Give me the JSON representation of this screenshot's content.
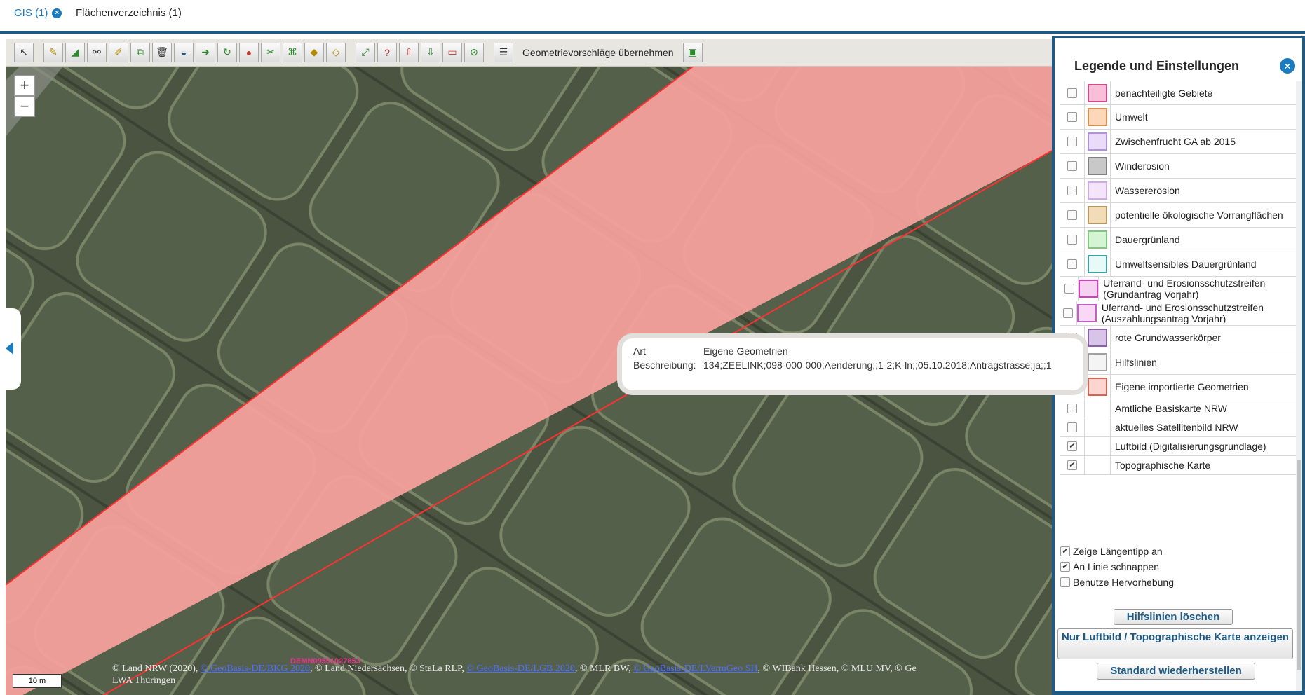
{
  "tabs": [
    {
      "label": "GIS (1)",
      "active": true
    },
    {
      "label": "Flächenverzeichnis (1)",
      "active": false
    }
  ],
  "toolbar": {
    "icons": [
      "pointer-icon",
      "pencil-icon",
      "polygon-icon",
      "split-icon",
      "edit-icon",
      "merge-icon",
      "trash-icon",
      "layer-icon",
      "move-icon",
      "rotate-icon",
      "marker-icon",
      "cut-icon",
      "join-icon",
      "paint-icon",
      "paint-edit-icon",
      "expand-icon",
      "help-icon",
      "upload-icon",
      "download-icon",
      "shape-icon",
      "lock-icon",
      "list-icon"
    ],
    "geometry_label": "Geometrievorschläge übernehmen"
  },
  "map": {
    "zoom_in": "+",
    "zoom_out": "−",
    "scale": "10 m",
    "stamp": "DEMN09551027853",
    "copyright_parts": [
      {
        "t": "© Land NRW (2020), ",
        "link": false
      },
      {
        "t": "© GeoBasis-DE/BKG 2020",
        "link": true
      },
      {
        "t": ", © Land Niedersachsen, © StaLa RLP, ",
        "link": false
      },
      {
        "t": "© GeoBasis-DE/LGB 2020",
        "link": true
      },
      {
        "t": ", © MLR BW, ",
        "link": false
      },
      {
        "t": "© GeoBasis-DE/LVermGeo SH",
        "link": true
      },
      {
        "t": ", © WIBank Hessen, © MLU MV, © Ge",
        "link": false
      }
    ],
    "copyright_line2": "LWA Thüringen"
  },
  "tooltip": {
    "rows": [
      {
        "key": "Art",
        "value": "Eigene Geometrien"
      },
      {
        "key": "Beschreibung:",
        "value": "134;ZEELINK;098-000-000;Aenderung;;1-2;K-ln;;05.10.2018;Antragstrasse;ja;;1"
      }
    ]
  },
  "panel": {
    "title": "Legende und Einstellungen",
    "layers": [
      {
        "label": "benachteiligte Gebiete",
        "checked": false,
        "swatch": "#f8c0d8",
        "border": "#d04a8a"
      },
      {
        "label": "Umwelt",
        "checked": false,
        "swatch": "#fcd7b8",
        "border": "#d89050"
      },
      {
        "label": "Zwischenfrucht GA ab 2015",
        "checked": false,
        "swatch": "#e8dcf8",
        "border": "#b090e0"
      },
      {
        "label": "Winderosion",
        "checked": false,
        "swatch": "#c8c8c8",
        "border": "#808080"
      },
      {
        "label": "Wassererosion",
        "checked": false,
        "swatch": "#f4e4fa",
        "border": "#d0a8e8"
      },
      {
        "label": "potentielle ökologische Vorrangflächen",
        "checked": false,
        "swatch": "#f2dcb8",
        "border": "#b89860"
      },
      {
        "label": "Dauergrünland",
        "checked": false,
        "swatch": "#d4f4d4",
        "border": "#80c880"
      },
      {
        "label": "Umweltsensibles Dauergrünland",
        "checked": false,
        "swatch": "#e8faf8",
        "border": "#40a0a0"
      },
      {
        "label": "Uferrand- und Erosionsschutzstreifen (Grundantrag Vorjahr)",
        "checked": false,
        "swatch": "#f8d0f0",
        "border": "#d040c0"
      },
      {
        "label": "Uferrand- und Erosionsschutzstreifen (Auszahlungsantrag Vorjahr)",
        "checked": false,
        "swatch": "#f8d8f4",
        "border": "#c060c0"
      },
      {
        "label": "rote Grundwasserkörper",
        "checked": false,
        "swatch": "#d8c4e8",
        "border": "#8a60a8"
      },
      {
        "label": "Hilfslinien",
        "checked": true,
        "swatch": "#f4f4f4",
        "border": "#a0a0a0"
      },
      {
        "label": "Eigene importierte Geometrien",
        "checked": true,
        "swatch": "#fcd4d0",
        "border": "#e06050"
      },
      {
        "label": "Amtliche Basiskarte NRW",
        "checked": false,
        "swatch": "",
        "border": ""
      },
      {
        "label": "aktuelles Satellitenbild NRW",
        "checked": false,
        "swatch": "",
        "border": ""
      },
      {
        "label": "Luftbild (Digitalisierungsgrundlage)",
        "checked": true,
        "swatch": "",
        "border": ""
      },
      {
        "label": "Topographische Karte",
        "checked": true,
        "swatch": "",
        "border": ""
      }
    ],
    "options": [
      {
        "label": "Zeige Längentipp an",
        "checked": true
      },
      {
        "label": "An Linie schnappen",
        "checked": true
      },
      {
        "label": "Benutze Hervorhebung",
        "checked": false
      }
    ],
    "btn_clear": "Hilfslinien löschen",
    "btn_only": "Nur Luftbild / Topographische Karte anzeigen",
    "btn_reset": "Standard wiederherstellen"
  }
}
